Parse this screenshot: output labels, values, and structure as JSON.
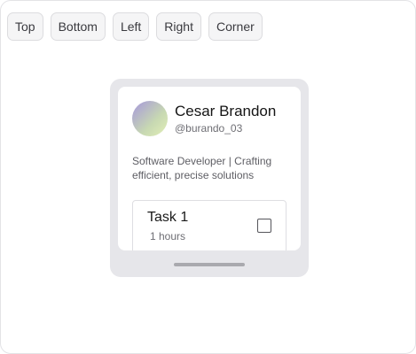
{
  "toolbar": {
    "buttons": [
      "Top",
      "Bottom",
      "Left",
      "Right",
      "Corner"
    ]
  },
  "profile": {
    "name": "Cesar Brandon",
    "handle": "@burando_03",
    "bio": "Software Developer | Crafting efficient, precise solutions"
  },
  "task": {
    "title": "Task 1",
    "duration": "1 hours",
    "checked": false
  },
  "colors": {
    "device_bezel": "#e6e6ea",
    "avatar_gradient_start": "#a697dc",
    "avatar_gradient_end": "#e2efb7"
  }
}
